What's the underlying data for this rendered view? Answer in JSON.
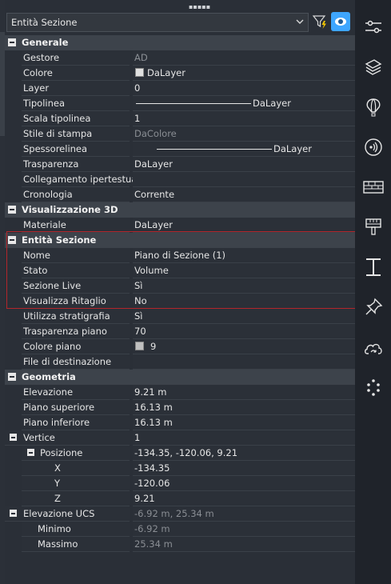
{
  "selector": {
    "value": "Entità Sezione"
  },
  "categories": {
    "generale": "Generale",
    "visualizzazione_3d": "Visualizzazione 3D",
    "entita_sezione": "Entità Sezione",
    "geometria": "Geometria"
  },
  "generale": [
    {
      "label": "Gestore",
      "value": "AD"
    },
    {
      "label": "Colore",
      "value": "DaLayer"
    },
    {
      "label": "Layer",
      "value": "0"
    },
    {
      "label": "Tipolinea",
      "value": "DaLayer"
    },
    {
      "label": "Scala tipolinea",
      "value": "1"
    },
    {
      "label": "Stile di stampa",
      "value": "DaColore"
    },
    {
      "label": "Spessorelinea",
      "value": "DaLayer"
    },
    {
      "label": "Trasparenza",
      "value": "DaLayer"
    },
    {
      "label": "Collegamento ipertestuale",
      "value": ""
    },
    {
      "label": "Cronologia",
      "value": "Corrente"
    }
  ],
  "visualizzazione_3d": [
    {
      "label": "Materiale",
      "value": "DaLayer"
    }
  ],
  "entita_sezione": [
    {
      "label": "Nome",
      "value": "Piano di Sezione (1)"
    },
    {
      "label": "Stato",
      "value": "Volume"
    },
    {
      "label": "Sezione Live",
      "value": "Sì"
    },
    {
      "label": "Visualizza Ritaglio",
      "value": "No"
    },
    {
      "label": "Utilizza stratigrafia",
      "value": "Sì"
    },
    {
      "label": "Trasparenza piano",
      "value": "70"
    },
    {
      "label": "Colore piano",
      "value": "9"
    },
    {
      "label": "File di destinazione",
      "value": ""
    }
  ],
  "geometria": [
    {
      "label": "Elevazione",
      "value": "9.21 m"
    },
    {
      "label": "Piano superiore",
      "value": "16.13 m"
    },
    {
      "label": "Piano inferiore",
      "value": "16.13 m"
    },
    {
      "label": "Vertice",
      "value": "1"
    },
    {
      "label": "Posizione",
      "value": "-134.35, -120.06, 9.21"
    },
    {
      "label": "X",
      "value": "-134.35"
    },
    {
      "label": "Y",
      "value": "-120.06"
    },
    {
      "label": "Z",
      "value": "9.21"
    },
    {
      "label": "Elevazione UCS",
      "value": "-6.92 m, 25.34 m"
    },
    {
      "label": "Minimo",
      "value": "-6.92 m"
    },
    {
      "label": "Massimo",
      "value": "25.34 m"
    }
  ],
  "colors": {
    "accent": "#3ea6ff",
    "highlight": "#b3262b",
    "colore_swatch": "#e0e0e0",
    "piano_swatch": "#c0c0c0"
  },
  "icons": [
    "properties-icon",
    "layers-icon",
    "hot-air-balloon-icon",
    "sound-icon",
    "wall-icon",
    "paint-brush-icon",
    "i-beam-icon",
    "pin-icon",
    "cloud-sync-icon",
    "dots-icon"
  ]
}
